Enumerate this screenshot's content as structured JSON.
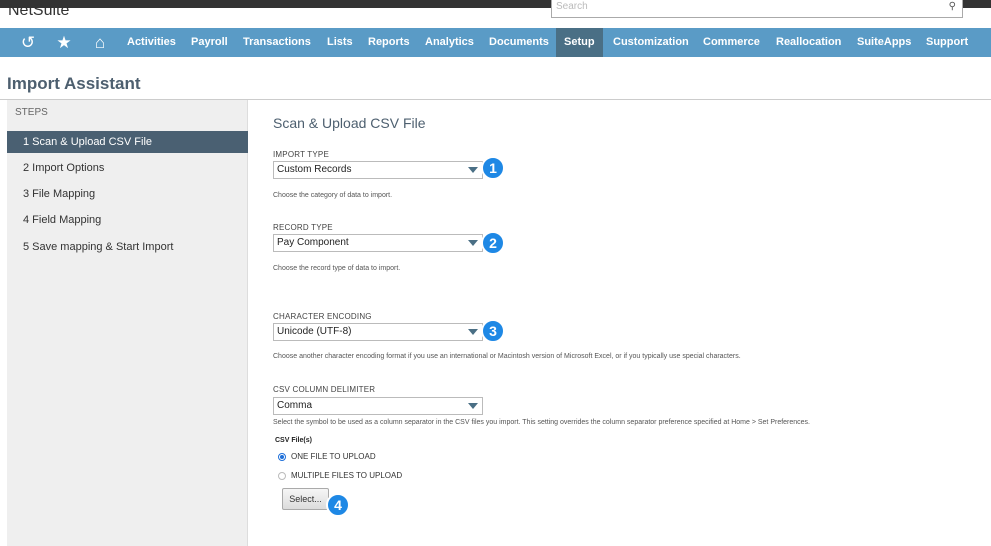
{
  "app": {
    "logo": "NetSuite",
    "search_placeholder": "Search"
  },
  "nav": {
    "items": [
      "Activities",
      "Payroll",
      "Transactions",
      "Lists",
      "Reports",
      "Analytics",
      "Documents",
      "Setup",
      "Customization",
      "Commerce",
      "Reallocation",
      "SuiteApps",
      "Support"
    ],
    "active": "Setup",
    "icons": [
      "recent-icon",
      "star-icon",
      "home-icon"
    ]
  },
  "page": {
    "title": "Import Assistant"
  },
  "sidebar": {
    "heading": "STEPS",
    "steps": [
      "1 Scan & Upload CSV File",
      "2 Import Options",
      "3 File Mapping",
      "4 Field Mapping",
      "5 Save mapping & Start Import"
    ]
  },
  "form": {
    "heading": "Scan & Upload CSV File",
    "import_type": {
      "label": "IMPORT TYPE",
      "value": "Custom Records",
      "help": "Choose the category of data to import."
    },
    "record_type": {
      "label": "RECORD TYPE",
      "value": "Pay Component",
      "help": "Choose the record type of data to import."
    },
    "encoding": {
      "label": "CHARACTER ENCODING",
      "value": "Unicode (UTF-8)",
      "help": "Choose another character encoding format if you use an international or Macintosh version of Microsoft Excel, or if you typically use special characters."
    },
    "delimiter": {
      "label": "CSV COLUMN DELIMITER",
      "value": "Comma",
      "help": "Select the symbol to be used as a column separator in the CSV files you import. This setting overrides the column separator preference specified at Home > Set Preferences."
    },
    "csv_files": {
      "label": "CSV File(s)",
      "option_one": "ONE FILE TO UPLOAD",
      "option_multiple": "MULTIPLE FILES TO UPLOAD",
      "selected": "ONE FILE TO UPLOAD"
    },
    "select_button": "Select..."
  },
  "badges": [
    "1",
    "2",
    "3",
    "4"
  ],
  "colors": {
    "nav": "#5a9bc6",
    "nav_active": "#4a6f85",
    "step_active": "#4a6072",
    "badge": "#1e88e5"
  }
}
